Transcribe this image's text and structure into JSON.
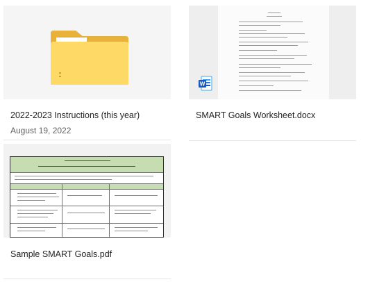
{
  "files": [
    {
      "name": "2022-2023 Instructions (this year)",
      "date": "August 19, 2022",
      "type_icon": "folder-icon",
      "colors": {
        "folder_back": "#e8b23a",
        "folder_front": "#ffd966"
      }
    },
    {
      "name": "SMART Goals Worksheet.docx",
      "type_icon": "word-icon",
      "colors": {
        "word_blue": "#185abd"
      }
    },
    {
      "name": "Sample SMART Goals.pdf",
      "type_icon": "pdf-preview",
      "colors": {
        "header_band": "#c6dcb1"
      }
    }
  ]
}
